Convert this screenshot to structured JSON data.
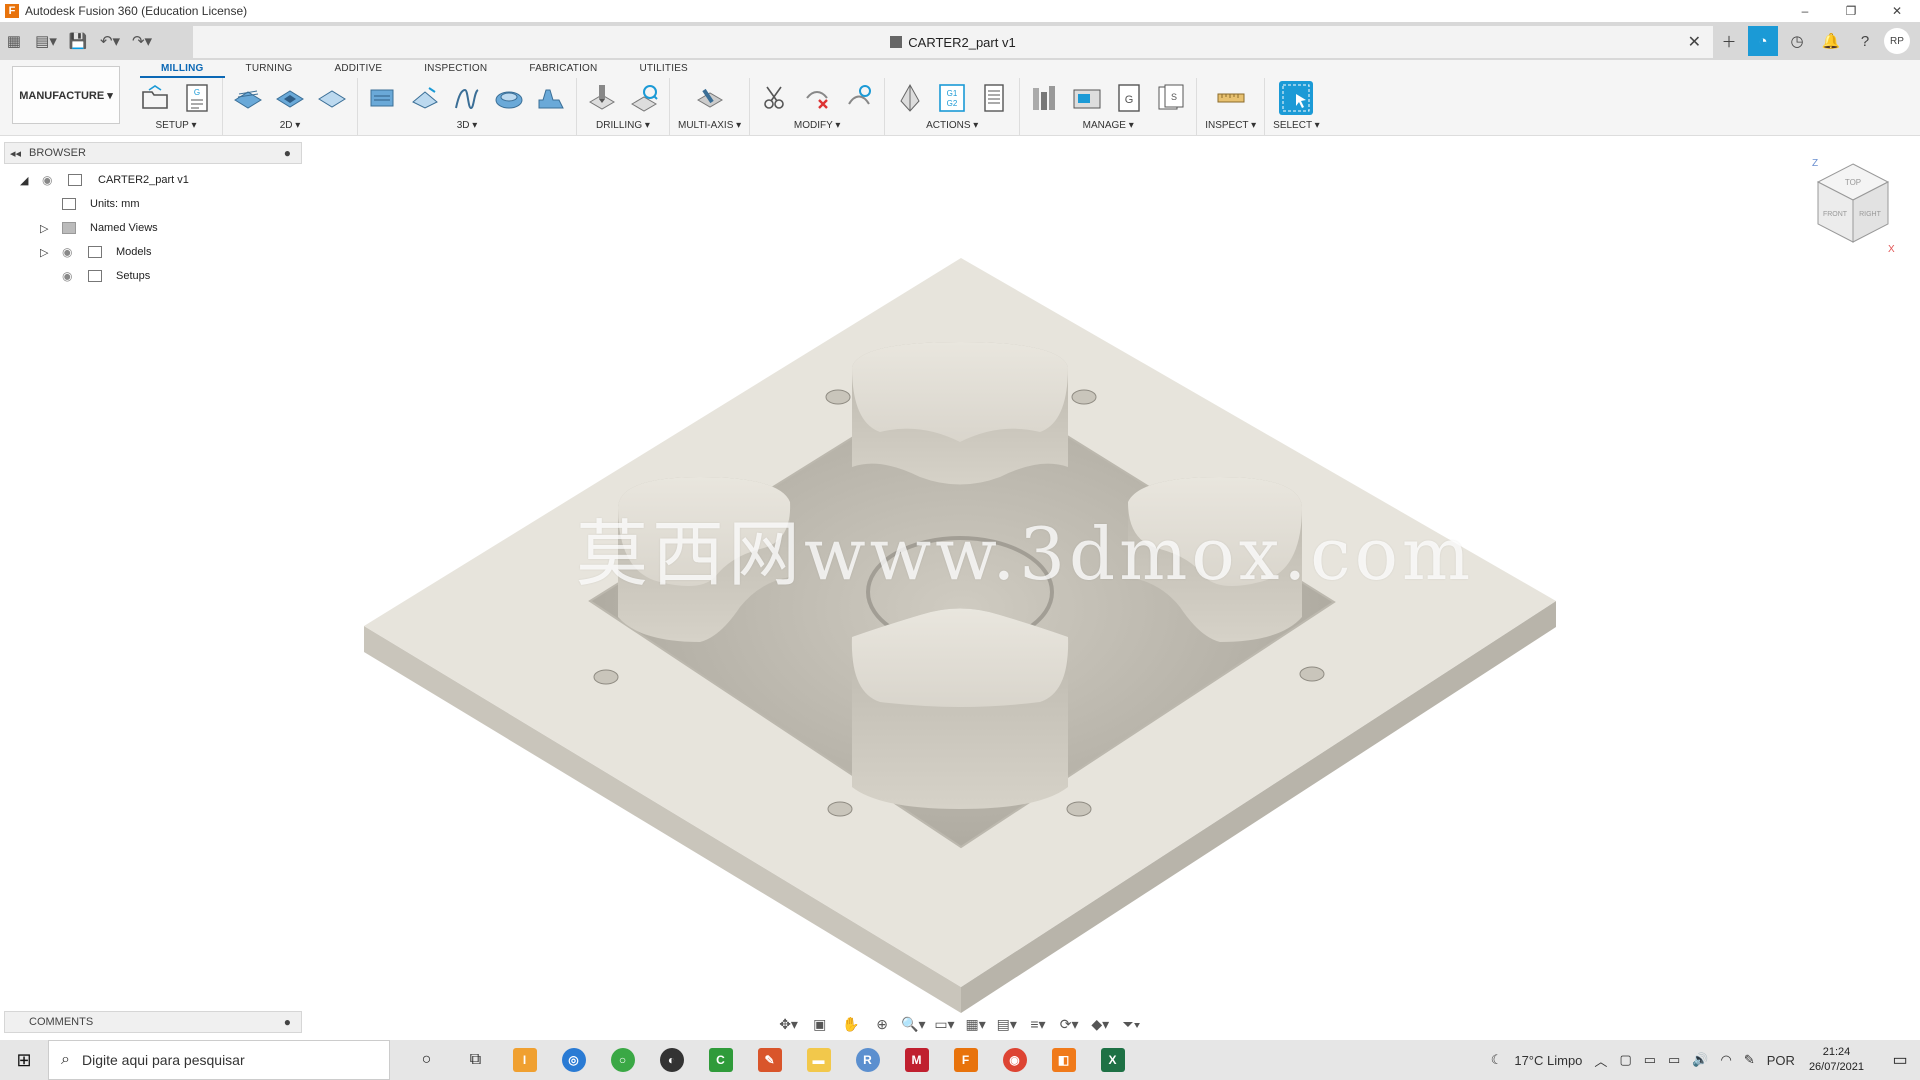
{
  "window": {
    "title": "Autodesk Fusion 360 (Education License)",
    "controls": [
      "–",
      "❐",
      "✕"
    ]
  },
  "document": {
    "tab_title": "CARTER2_part v1",
    "close": "✕"
  },
  "ribbon": {
    "tabs": [
      "MILLING",
      "TURNING",
      "ADDITIVE",
      "INSPECTION",
      "FABRICATION",
      "UTILITIES"
    ],
    "active_tab": "MILLING",
    "workspace": "MANUFACTURE ▾",
    "groups": [
      {
        "label": "SETUP ▾"
      },
      {
        "label": "2D ▾"
      },
      {
        "label": "3D ▾"
      },
      {
        "label": "DRILLING ▾"
      },
      {
        "label": "MULTI-AXIS ▾"
      },
      {
        "label": "MODIFY ▾"
      },
      {
        "label": "ACTIONS ▾"
      },
      {
        "label": "MANAGE ▾"
      },
      {
        "label": "INSPECT ▾"
      },
      {
        "label": "SELECT ▾"
      }
    ],
    "accent": "#0b68b5"
  },
  "browser": {
    "title": "BROWSER",
    "collapse_icon": "◂◂",
    "pin_icon": "●",
    "tree": {
      "root": "CARTER2_part v1",
      "units": "Units: mm",
      "named_views": "Named Views",
      "models": "Models",
      "setups": "Setups"
    }
  },
  "viewcube": {
    "top": "TOP",
    "front": "FRONT",
    "right": "RIGHT",
    "z": "Z",
    "x": "X"
  },
  "watermark": "莫西网www.3dmox.com",
  "comments": {
    "title": "COMMENTS",
    "pin_icon": "●"
  },
  "taskbar": {
    "search_placeholder": "Digite aqui para pesquisar",
    "weather": "17°C  Limpo",
    "language": "POR",
    "time": "21:24",
    "date": "26/07/2021"
  },
  "profile": {
    "initials": "RP"
  }
}
